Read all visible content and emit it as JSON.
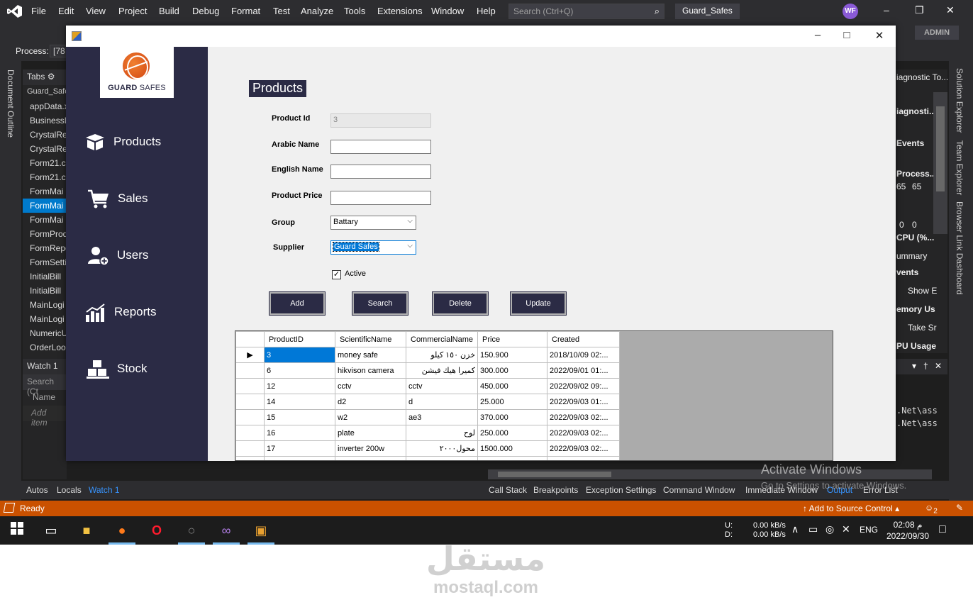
{
  "vs": {
    "menu": [
      "File",
      "Edit",
      "View",
      "Project",
      "Build",
      "Debug",
      "Format",
      "Test",
      "Analyze",
      "Tools",
      "Extensions",
      "Window",
      "Help"
    ],
    "search_placeholder": "Search (Ctrl+Q)",
    "solution_name": "Guard_Safes",
    "user_initials": "WF",
    "admin_label": "ADMIN",
    "process_label": "Process:",
    "process_value": "[78",
    "document_outline": "Document Outline",
    "tabs_header": "Tabs",
    "tabs": [
      "Guard_Safe",
      "appData.x",
      "BusinessL",
      "CrystalRe",
      "CrystalRe",
      "Form21.c",
      "Form21.c",
      "FormMai",
      "FormMai",
      "FormMai",
      "FormProd",
      "FormRepo",
      "FormSetti",
      "InitialBill",
      "InitialBill",
      "MainLogi",
      "MainLogi",
      "NumericU",
      "OrderLoo"
    ],
    "watch_header": "Watch 1",
    "watch_search": "Search (Ct",
    "watch_col_name": "Name",
    "watch_add": "Add item",
    "diag": {
      "title": "iagnostic To...",
      "session": "iagnosti...",
      "events": "Events",
      "process": "Process...",
      "v1": "65",
      "v2": "65",
      "z1": "0",
      "z2": "0",
      "cpu": "CPU (%...",
      "summary": "ummary",
      "events2": "vents",
      "show": "Show E",
      "memory": "emory Us",
      "take": "Take Sr",
      "cpu_usage": "PU Usage"
    },
    "right_strip": [
      "Solution Explorer",
      "Team Explorer",
      "Browser Link Dashboard"
    ],
    "output_lines": [
      ".Net\\ass",
      ".Net\\ass"
    ],
    "bottom_left_tabs": [
      "Autos",
      "Locals",
      "Watch 1"
    ],
    "bottom_right_tabs": [
      "Call Stack",
      "Breakpoints",
      "Exception Settings",
      "Command Window",
      "Immediate Window",
      "Output",
      "Error List"
    ],
    "activate_title": "Activate Windows",
    "activate_sub": "Go to Settings to activate Windows.",
    "status_ready": "Ready",
    "status_source": "Add to Source Control",
    "status_notif": "2"
  },
  "taskbar": {
    "net_labels": [
      "U:",
      "D:"
    ],
    "net_values": [
      "0.00 kB/s",
      "0.00 kB/s"
    ],
    "lang": "ENG",
    "time": "02:08 م",
    "date": "2022/09/30"
  },
  "watermark": {
    "arabic": "مستقل",
    "latin": "mostaql.com"
  },
  "app": {
    "logo_bold": "GUARD",
    "logo_light": "SAFES",
    "nav": [
      "Products",
      "Sales",
      "Users",
      "Reports",
      "Stock"
    ],
    "page_title": "Products",
    "fields": {
      "product_id_label": "Product Id",
      "product_id_value": "3",
      "arabic_name_label": "Arabic Name",
      "arabic_name_value": "",
      "english_name_label": "English Name",
      "english_name_value": "",
      "price_label": "Product Price",
      "price_value": "",
      "group_label": "Group",
      "group_value": "Battary",
      "supplier_label": "Supplier",
      "supplier_value": "Guard Safes",
      "active_label": "Active",
      "active_checked": true
    },
    "buttons": [
      "Add",
      "Search",
      "Delete",
      "Update"
    ],
    "grid": {
      "columns": [
        "ProductID",
        "ScientificName",
        "CommercialName",
        "Price",
        "Created"
      ],
      "rows": [
        [
          "3",
          "money safe",
          "خزن ١٥٠ كيلو",
          "150.900",
          "2018/10/09 02:..."
        ],
        [
          "6",
          "hikvison camera",
          "كميرا هيك فيشن",
          "300.000",
          "2022/09/01 01:..."
        ],
        [
          "12",
          "cctv",
          "cctv",
          "450.000",
          "2022/09/02 09:..."
        ],
        [
          "14",
          "d2",
          "d",
          "25.000",
          "2022/09/03 01:..."
        ],
        [
          "15",
          "w2",
          "ae3",
          "370.000",
          "2022/09/03 02:..."
        ],
        [
          "16",
          "plate",
          "لوح",
          "250.000",
          "2022/09/03 02:..."
        ],
        [
          "17",
          "inverter 200w",
          "محول٢٠٠٠",
          "1500.000",
          "2022/09/03 02:..."
        ]
      ]
    }
  }
}
